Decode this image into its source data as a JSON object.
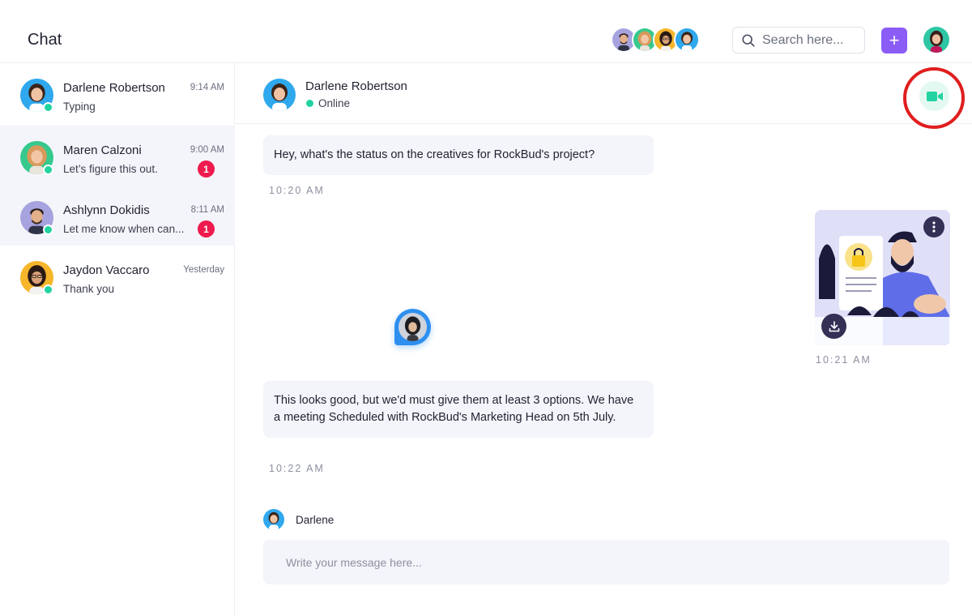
{
  "header": {
    "title": "Chat",
    "search_placeholder": "Search here...",
    "add_label": "+"
  },
  "conversations": [
    {
      "name": "Darlene Robertson",
      "preview": "Typing",
      "time": "9:14 AM",
      "online": true,
      "unread": ""
    },
    {
      "name": "Maren Calzoni",
      "preview": "Let’s figure this out.",
      "time": "9:00 AM",
      "online": true,
      "unread": "1"
    },
    {
      "name": "Ashlynn Dokidis",
      "preview": "Let me know when can...",
      "time": "8:11 AM",
      "online": true,
      "unread": "1"
    },
    {
      "name": "Jaydon Vaccaro",
      "preview": "Thank you",
      "time": "Yesterday",
      "online": true,
      "unread": ""
    }
  ],
  "chat": {
    "contact_name": "Darlene Robertson",
    "status": "Online",
    "messages": [
      {
        "text": "Hey, what's the status on the creatives for RockBud's project?",
        "time": "10:20 AM"
      },
      {
        "image_time": "10:21 AM"
      },
      {
        "text": "This looks good, but we'd must give them at least 3 options. We have a meeting Scheduled with RockBud's Marketing Head on 5th July.",
        "time": "10:22 AM"
      }
    ],
    "typing_name": "Darlene",
    "composer_placeholder": "Write your message here..."
  },
  "colors": {
    "accent": "#8b5cf6",
    "online": "#22d3a1",
    "badge": "#ef1a4d",
    "bubble": "#f4f5fa",
    "video": "#22d3a1",
    "highlight_ring": "#e01e1e"
  }
}
